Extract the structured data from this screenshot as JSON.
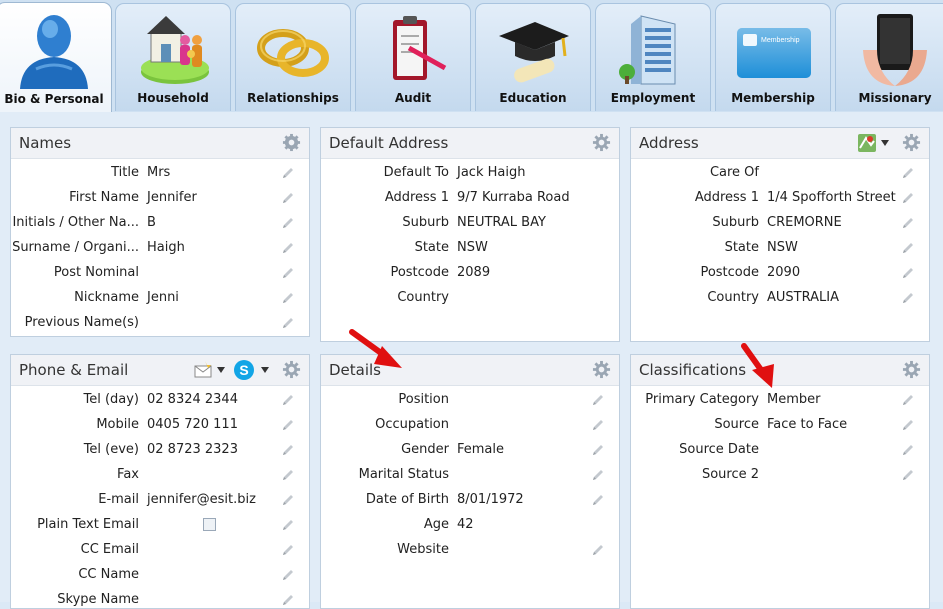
{
  "tabs": [
    {
      "label": "Bio & Personal",
      "icon": "person-icon",
      "active": true
    },
    {
      "label": "Household",
      "icon": "household-icon"
    },
    {
      "label": "Relationships",
      "icon": "rings-icon"
    },
    {
      "label": "Audit",
      "icon": "clipboard-icon"
    },
    {
      "label": "Education",
      "icon": "graduation-cap-icon"
    },
    {
      "label": "Employment",
      "icon": "office-building-icon"
    },
    {
      "label": "Membership",
      "icon": "membership-card-icon"
    },
    {
      "label": "Missionary",
      "icon": "tablet-hands-icon"
    }
  ],
  "membership_card_text": "Membership",
  "names": {
    "title": "Names",
    "rows": [
      {
        "k": "Title",
        "v": "Mrs"
      },
      {
        "k": "First Name",
        "v": "Jennifer"
      },
      {
        "k": "Initials / Other Na...",
        "v": "B"
      },
      {
        "k": "Surname / Organi...",
        "v": "Haigh"
      },
      {
        "k": "Post Nominal",
        "v": ""
      },
      {
        "k": "Nickname",
        "v": "Jenni"
      },
      {
        "k": "Previous Name(s)",
        "v": ""
      }
    ]
  },
  "default_address": {
    "title": "Default Address",
    "rows": [
      {
        "k": "Default To",
        "v": "Jack Haigh"
      },
      {
        "k": "Address 1",
        "v": "9/7 Kurraba Road"
      },
      {
        "k": "Suburb",
        "v": "NEUTRAL BAY"
      },
      {
        "k": "State",
        "v": "NSW"
      },
      {
        "k": "Postcode",
        "v": "2089"
      },
      {
        "k": "Country",
        "v": ""
      }
    ]
  },
  "address": {
    "title": "Address",
    "rows": [
      {
        "k": "Care Of",
        "v": ""
      },
      {
        "k": "Address 1",
        "v": "1/4 Spofforth Street"
      },
      {
        "k": "Suburb",
        "v": "CREMORNE"
      },
      {
        "k": "State",
        "v": "NSW"
      },
      {
        "k": "Postcode",
        "v": "2090"
      },
      {
        "k": "Country",
        "v": "AUSTRALIA"
      }
    ]
  },
  "phone_email": {
    "title": "Phone & Email",
    "rows": [
      {
        "k": "Tel (day)",
        "v": "02 8324 2344"
      },
      {
        "k": "Mobile",
        "v": "0405 720 111"
      },
      {
        "k": "Tel (eve)",
        "v": "02 8723 2323"
      },
      {
        "k": "Fax",
        "v": ""
      },
      {
        "k": "E-mail",
        "v": "jennifer@esit.biz"
      },
      {
        "k": "Plain Text Email",
        "v": ""
      },
      {
        "k": "CC Email",
        "v": ""
      },
      {
        "k": "CC Name",
        "v": ""
      },
      {
        "k": "Skype Name",
        "v": ""
      }
    ]
  },
  "details": {
    "title": "Details",
    "rows": [
      {
        "k": "Position",
        "v": ""
      },
      {
        "k": "Occupation",
        "v": ""
      },
      {
        "k": "Gender",
        "v": "Female"
      },
      {
        "k": "Marital Status",
        "v": ""
      },
      {
        "k": "Date of Birth",
        "v": "8/01/1972"
      },
      {
        "k": "Age",
        "v": "42"
      },
      {
        "k": "Website",
        "v": ""
      }
    ]
  },
  "classifications": {
    "title": "Classifications",
    "rows": [
      {
        "k": "Primary  Category",
        "v": "Member"
      },
      {
        "k": "Source",
        "v": "Face to Face"
      },
      {
        "k": "Source Date",
        "v": ""
      },
      {
        "k": "Source 2",
        "v": ""
      }
    ]
  },
  "colors": {
    "accent_arrow": "#e01010",
    "tab_bg": "#c4d9ee",
    "panel_head": "#f0f2f6"
  }
}
